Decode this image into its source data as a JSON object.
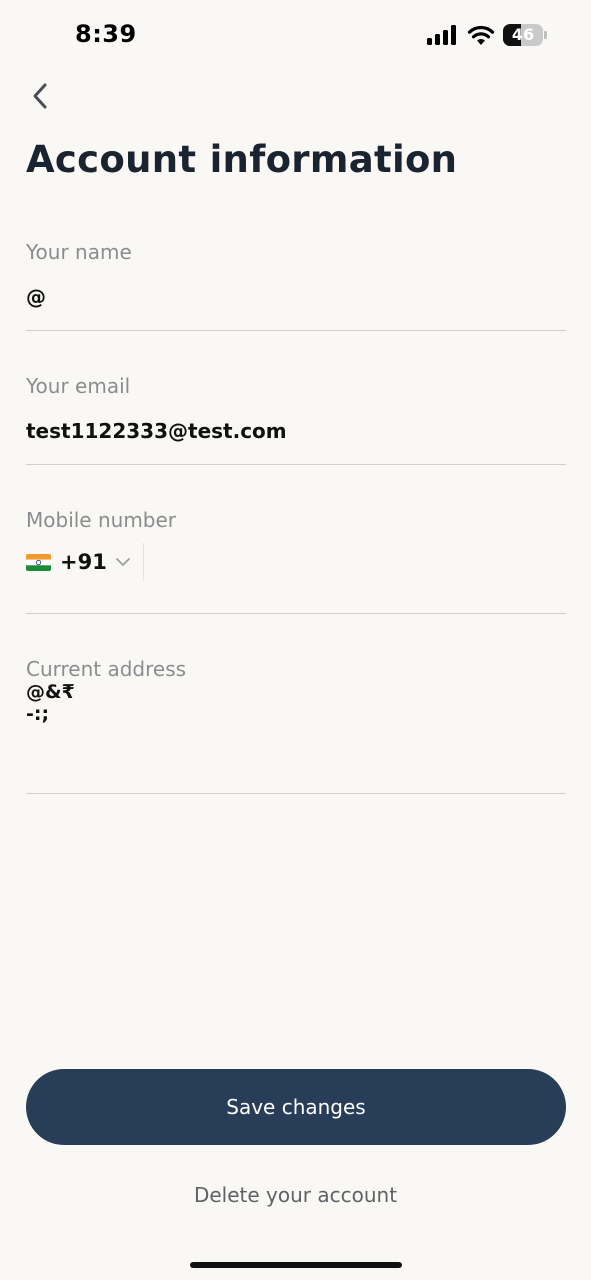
{
  "status_bar": {
    "time": "8:39",
    "battery_level": "46",
    "battery_fraction": 0.46,
    "icons": [
      "signal-icon",
      "wifi-icon",
      "battery-icon"
    ]
  },
  "header": {
    "back_icon": "chevron-left-icon",
    "title": "Account information"
  },
  "form": {
    "name": {
      "label": "Your name",
      "value": "@"
    },
    "email": {
      "label": "Your email",
      "value": "test1122333@test.com"
    },
    "mobile": {
      "label": "Mobile number",
      "country_flag": "india-flag-icon",
      "dial_code": "+91",
      "value": ""
    },
    "address": {
      "label": "Current address",
      "value": "@&₹\n-:;"
    }
  },
  "actions": {
    "save_label": "Save changes",
    "delete_label": "Delete your account"
  },
  "colors": {
    "background": "#faf8f5",
    "title": "#1a2330",
    "label": "#8a8d90",
    "primary_button": "#283d58",
    "divider": "#cfcfcf"
  }
}
